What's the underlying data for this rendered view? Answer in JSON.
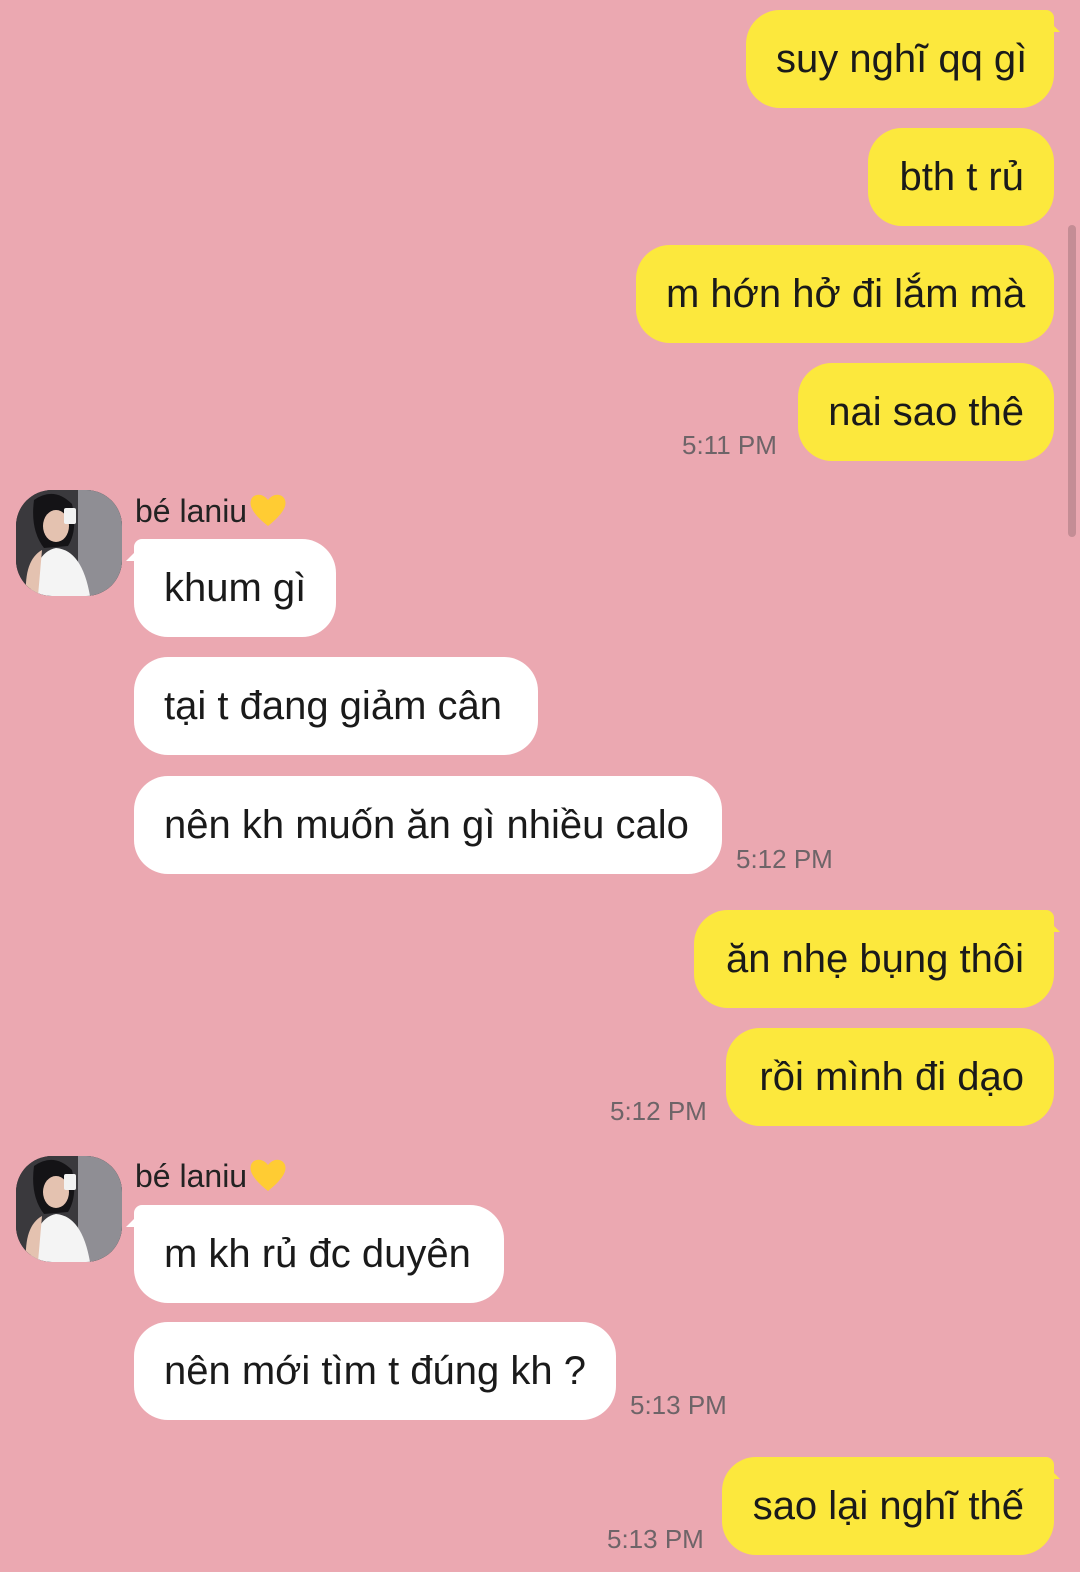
{
  "colors": {
    "background": "#eba8b1",
    "outgoing_bubble": "#fce83d",
    "incoming_bubble": "#ffffff",
    "timestamp": "#6e6468"
  },
  "messages_out_1": [
    "suy nghĩ qq gì",
    "bth t rủ",
    "m hớn hở đi lắm mà",
    "nai sao thê"
  ],
  "time_out_1": "5:11 PM",
  "sender_1": {
    "name": "bé laniu",
    "emoji": "yellow-heart-icon"
  },
  "messages_in_1": [
    "khum gì",
    "tại t đang giảm cân",
    "nên kh muốn ăn gì nhiều calo"
  ],
  "time_in_1": "5:12 PM",
  "messages_out_2": [
    "ăn nhẹ bụng thôi",
    "rồi mình đi dạo"
  ],
  "time_out_2": "5:12 PM",
  "sender_2": {
    "name": "bé laniu",
    "emoji": "yellow-heart-icon"
  },
  "messages_in_2": [
    "m kh rủ đc duyên",
    "nên mới tìm t đúng kh ?"
  ],
  "time_in_2": "5:13 PM",
  "messages_out_3": [
    "sao lại nghĩ thế"
  ],
  "time_out_3": "5:13 PM"
}
